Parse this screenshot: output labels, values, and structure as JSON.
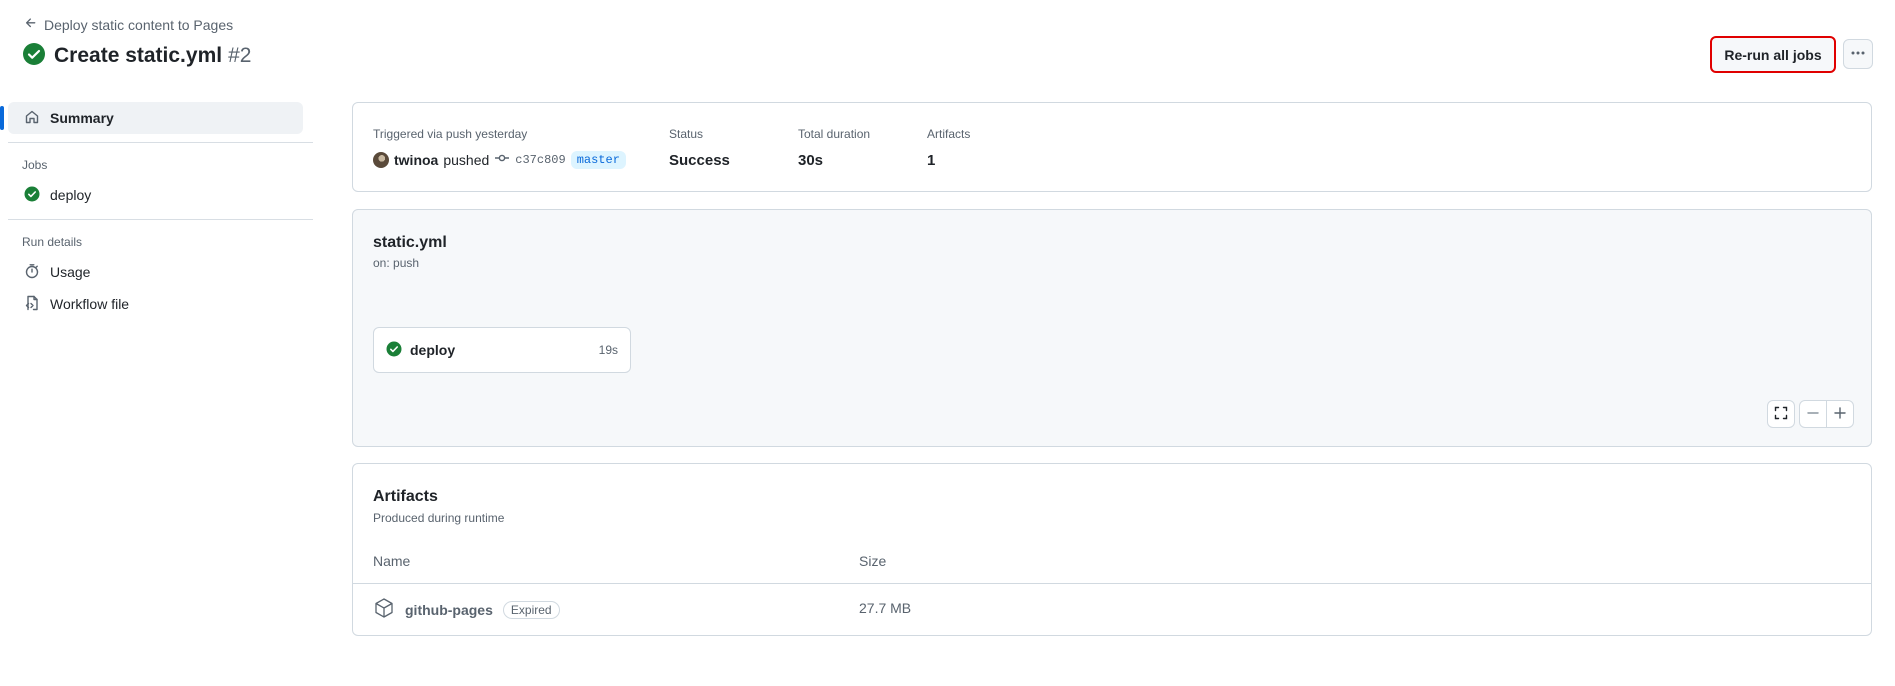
{
  "header": {
    "back_label": "Deploy static content to Pages",
    "title": "Create static.yml",
    "run_number": "#2",
    "rerun_label": "Re-run all jobs",
    "more_label": "···"
  },
  "sidebar": {
    "summary_label": "Summary",
    "jobs_heading": "Jobs",
    "jobs": [
      {
        "label": "deploy",
        "status": "success"
      }
    ],
    "run_details_heading": "Run details",
    "usage_label": "Usage",
    "workflow_file_label": "Workflow file"
  },
  "summary": {
    "trigger_label": "Triggered via push yesterday",
    "user": "twinoa",
    "action": "pushed",
    "sha": "c37c809",
    "branch": "master",
    "status_label": "Status",
    "status_value": "Success",
    "duration_label": "Total duration",
    "duration_value": "30s",
    "artifacts_label": "Artifacts",
    "artifacts_value": "1"
  },
  "graph": {
    "workflow_name": "static.yml",
    "trigger": "on: push",
    "job_name": "deploy",
    "job_duration": "19s"
  },
  "artifacts": {
    "title": "Artifacts",
    "subtitle": "Produced during runtime",
    "col_name": "Name",
    "col_size": "Size",
    "rows": [
      {
        "name": "github-pages",
        "badge": "Expired",
        "size": "27.7 MB"
      }
    ]
  },
  "colors": {
    "success": "#1a7f37",
    "accent": "#0969da",
    "highlight_border": "#e00000"
  }
}
